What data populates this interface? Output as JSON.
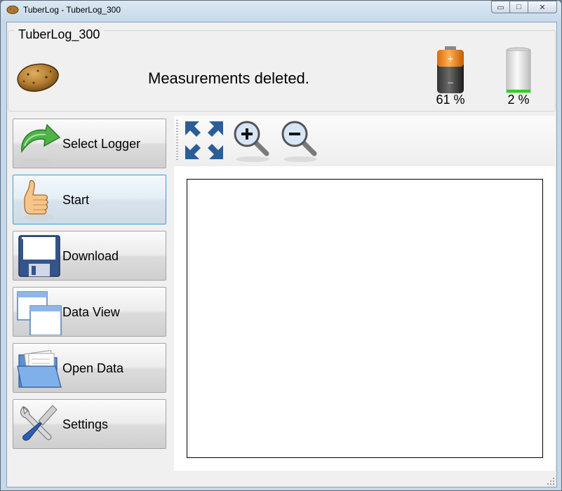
{
  "window": {
    "title": "TuberLog - TuberLog_300",
    "minimize_glyph": "▭",
    "maximize_glyph": "□",
    "close_glyph": "✕"
  },
  "header": {
    "group_title": "TuberLog_300",
    "status_message": "Measurements deleted.",
    "battery_logger": {
      "label": "61 %",
      "level": 0.61,
      "color": "#f08a1c"
    },
    "battery_device": {
      "label": "2 %",
      "level": 0.02,
      "color": "#2fd11f"
    }
  },
  "nav": {
    "select_logger": {
      "label": "Select Logger",
      "icon": "green-arrow-icon"
    },
    "start": {
      "label": "Start",
      "icon": "thumbs-up-icon"
    },
    "download": {
      "label": "Download",
      "icon": "floppy-disk-icon"
    },
    "data_view": {
      "label": "Data View",
      "icon": "windows-icon"
    },
    "open_data": {
      "label": "Open Data",
      "icon": "folder-icon"
    },
    "settings": {
      "label": "Settings",
      "icon": "wrench-screwdriver-icon"
    }
  },
  "toolbar": {
    "fit": {
      "icon": "expand-arrows-icon"
    },
    "zoom_in": {
      "icon": "zoom-in-icon"
    },
    "zoom_out": {
      "icon": "zoom-out-icon"
    }
  },
  "colors": {
    "active_border": "#3c9fd6",
    "toolbar_blue": "#2c5d98"
  }
}
